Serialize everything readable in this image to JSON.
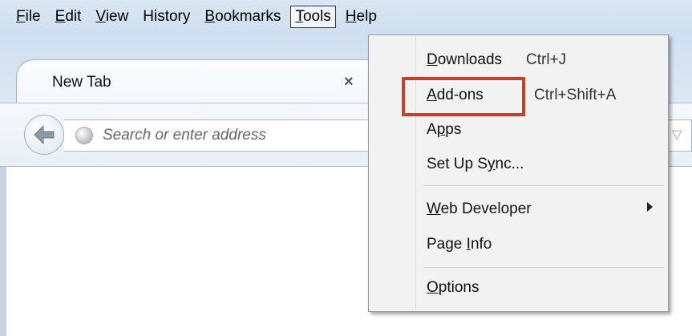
{
  "menubar": {
    "items": [
      {
        "first": "F",
        "rest": "ile"
      },
      {
        "first": "E",
        "rest": "dit"
      },
      {
        "first": "V",
        "rest": "iew"
      },
      {
        "first": "Hi",
        "rest": "story"
      },
      {
        "first": "B",
        "rest": "ookmarks"
      },
      {
        "first": "T",
        "rest": "ools"
      },
      {
        "first": "H",
        "rest": "elp"
      }
    ]
  },
  "tab": {
    "title": "New Tab",
    "close_glyph": "×"
  },
  "urlbar": {
    "placeholder": "Search or enter address",
    "dropdown_glyph": "▽"
  },
  "tools_menu": {
    "downloads": {
      "acc": "D",
      "rest": "ownloads",
      "shortcut": "Ctrl+J"
    },
    "addons": {
      "acc": "A",
      "rest": "dd-ons",
      "shortcut": "Ctrl+Shift+A"
    },
    "apps": {
      "pre": "A",
      "acc": "p",
      "rest": "ps"
    },
    "sync": {
      "pre": "Set Up S",
      "acc": "y",
      "rest": "nc..."
    },
    "web_developer": {
      "acc": "W",
      "rest": "eb Developer"
    },
    "page_info": {
      "pre": "Page ",
      "acc": "I",
      "rest": "nfo"
    },
    "options": {
      "acc": "O",
      "rest": "ptions"
    }
  },
  "colors": {
    "highlight": "#c0442b",
    "chrome": "#d9e6f4"
  }
}
